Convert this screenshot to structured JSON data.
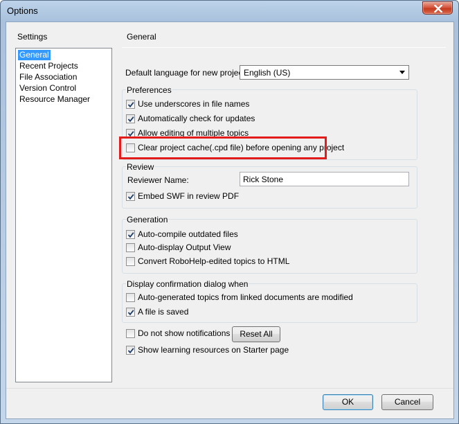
{
  "window": {
    "title": "Options"
  },
  "sidebar": {
    "label": "Settings",
    "items": [
      {
        "label": "General",
        "selected": true
      },
      {
        "label": "Recent Projects"
      },
      {
        "label": "File Association"
      },
      {
        "label": "Version Control"
      },
      {
        "label": "Resource Manager"
      }
    ]
  },
  "panel": {
    "title": "General",
    "language": {
      "label": "Default language for new projects:",
      "value": "English (US)"
    },
    "preferences": {
      "label": "Preferences",
      "options": [
        {
          "label": "Use underscores in file names",
          "checked": true
        },
        {
          "label": "Automatically check for updates",
          "checked": true
        },
        {
          "label": "Allow editing of multiple topics",
          "checked": true
        },
        {
          "label": "Clear project cache(.cpd file) before opening any project",
          "checked": false
        }
      ]
    },
    "review": {
      "label": "Review",
      "reviewer_label": "Reviewer Name:",
      "reviewer_value": "Rick Stone",
      "embed_swf": {
        "label": "Embed SWF in review PDF",
        "checked": true
      }
    },
    "generation": {
      "label": "Generation",
      "options": [
        {
          "label": "Auto-compile outdated files",
          "checked": true
        },
        {
          "label": "Auto-display Output View",
          "checked": false
        },
        {
          "label": "Convert RoboHelp-edited topics to HTML",
          "checked": false
        }
      ]
    },
    "confirmation": {
      "label": "Display confirmation dialog when",
      "options": [
        {
          "label": "Auto-generated topics from linked documents are modified",
          "checked": false
        },
        {
          "label": "A file is saved",
          "checked": true
        }
      ]
    },
    "notifications": {
      "label": "Do not show notifications",
      "checked": false
    },
    "reset_all": "Reset All",
    "learning": {
      "label": "Show learning resources on Starter page",
      "checked": true
    }
  },
  "footer": {
    "ok": "OK",
    "cancel": "Cancel"
  },
  "colors": {
    "selection": "#3399ff",
    "highlight_box": "#e21b1b",
    "title_close": "#c43a1f"
  }
}
